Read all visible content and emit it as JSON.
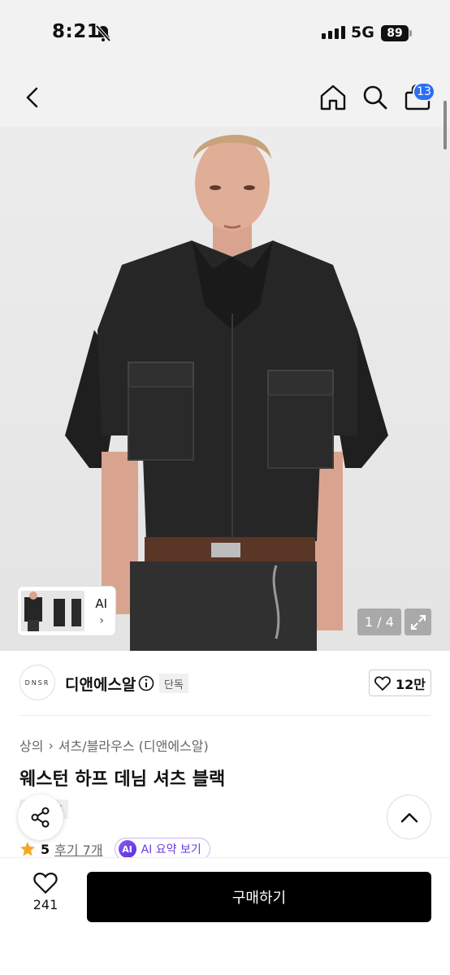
{
  "status_bar": {
    "time": "8:21",
    "network": "5G",
    "battery": "89"
  },
  "nav": {
    "cart_count": "13",
    "icons": [
      "back-icon",
      "home-icon",
      "search-icon",
      "shopping-bag-icon"
    ]
  },
  "gallery": {
    "pager": "1 / 4",
    "thumb_label": "AI",
    "thumb_chevron": "›"
  },
  "brand": {
    "logo_text": "DNSR",
    "name": "디앤에스알",
    "tag": "단독",
    "likes": "12만"
  },
  "product": {
    "breadcrumb": [
      "상의",
      "셔츠/블라우스 (디앤에스알)"
    ],
    "breadcrumb_sep": "›",
    "title": "웨스턴 하프 데님 셔츠 블랙",
    "tag": "단독",
    "rating": "5",
    "reviews": "후기 7개",
    "ai_badge": "AI",
    "ai_summary": "AI 요약 보기"
  },
  "bottom": {
    "wish_count": "241",
    "buy_label": "구매하기"
  },
  "colors": {
    "accent_blue": "#2a6ef5",
    "ai_purple": "#6a3ce0",
    "star": "#f5a623",
    "buy_bg": "#000000"
  }
}
